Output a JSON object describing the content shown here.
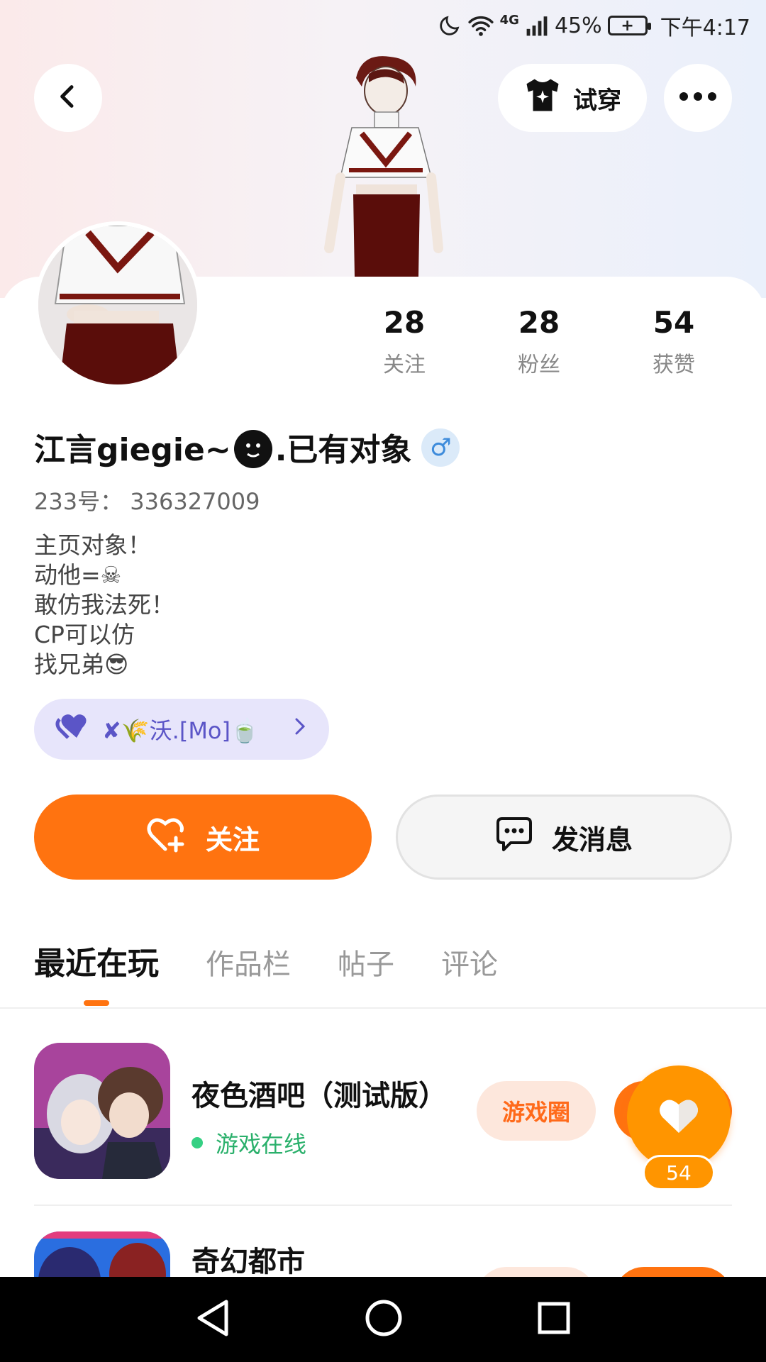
{
  "status_bar": {
    "network": "4G",
    "battery": "45%",
    "time": "下午4:17"
  },
  "header": {
    "tryon_label": "试穿"
  },
  "stats": [
    {
      "value": "28",
      "label": "关注"
    },
    {
      "value": "28",
      "label": "粉丝"
    },
    {
      "value": "54",
      "label": "获赞"
    }
  ],
  "profile": {
    "username": "江言giegie~",
    "username_suffix": ".已有对象",
    "gender_symbol": "♂",
    "user_id": "233号： 336327009",
    "bio": [
      "主页对象！",
      "动他=☠",
      "敢仿我法死！",
      "CP可以仿",
      "找兄弟😎"
    ],
    "tag": "✘🌾沃.[Mo]🍵"
  },
  "actions": {
    "follow_label": "关注",
    "message_label": "发消息"
  },
  "tabs": [
    "最近在玩",
    "作品栏",
    "帖子",
    "评论"
  ],
  "games": [
    {
      "title": "夜色酒吧（测试版）",
      "status": "游戏在线",
      "circle_label": "游戏圈"
    },
    {
      "title": "奇幻都市"
    }
  ],
  "like_fab": {
    "count": "54"
  },
  "colors": {
    "accent": "#ff7310",
    "like": "#ff9500",
    "online": "#35d083",
    "tag_bg": "#e7e5fb"
  }
}
